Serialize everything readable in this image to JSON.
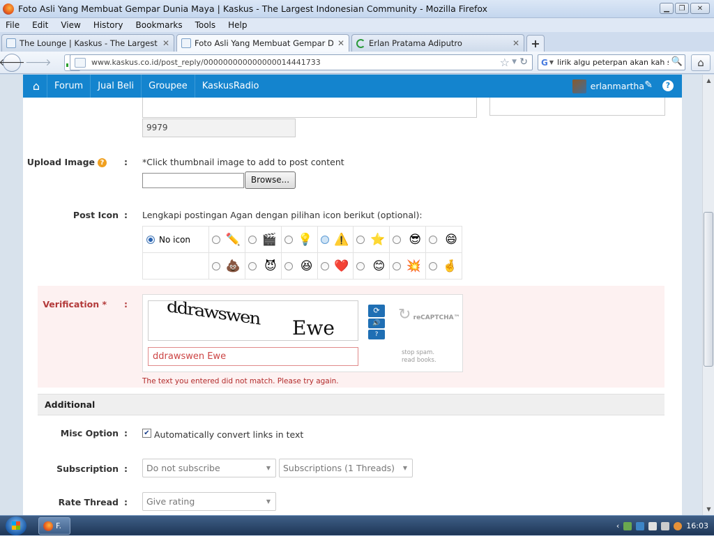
{
  "window": {
    "title": "Foto Asli Yang Membuat Gempar Dunia Maya | Kaskus - The Largest Indonesian Community - Mozilla Firefox",
    "controls": [
      "minimize",
      "maximize",
      "close"
    ]
  },
  "menu": [
    "File",
    "Edit",
    "View",
    "History",
    "Bookmarks",
    "Tools",
    "Help"
  ],
  "tabs": [
    {
      "label": "The Lounge | Kaskus - The Largest Indon..."
    },
    {
      "label": "Foto Asli Yang Membuat Gempar Dunia M..."
    },
    {
      "label": "Erlan Pratama Adiputro"
    }
  ],
  "nav": {
    "url": "www.kaskus.co.id/post_reply/000000000000000014441733",
    "search_query": "lirik algu peterpan akan kah semu"
  },
  "site_nav": {
    "items": [
      "Forum",
      "Jual Beli",
      "Groupee",
      "KaskusRadio"
    ],
    "username": "erlanmartha"
  },
  "form": {
    "char_counter": "9979",
    "upload": {
      "label": "Upload Image",
      "hint": "*Click thumbnail image to add to post content",
      "browse_label": "Browse..."
    },
    "post_icon": {
      "label": "Post Icon",
      "hint": "Lengkapi postingan Agan dengan pilihan icon berikut (optional):",
      "no_icon_label": "No icon",
      "row1": [
        "✏️",
        "🎬",
        "💡",
        "⚠️",
        "⭐",
        "😎",
        "😄"
      ],
      "row2": [
        "💩",
        "😈",
        "😆",
        "❤️",
        "😊",
        "💥",
        "🤞"
      ]
    },
    "verification": {
      "label": "Verification",
      "required_mark": "*",
      "captcha_word1": "ddrawswen",
      "captcha_word2": "Ewe",
      "input_value": "ddrawswen Ewe",
      "recaptcha_brand": "reCAPTCHA™",
      "stop_spam_line1": "stop spam.",
      "stop_spam_line2": "read books.",
      "error": "The text you entered did not match. Please try again."
    },
    "additional": {
      "heading": "Additional",
      "misc_label": "Misc Option",
      "misc_checkbox": "Automatically convert links in text",
      "subscription_label": "Subscription",
      "subscription_value": "Do not subscribe",
      "subscriptions_value": "Subscriptions (1 Threads)",
      "rate_label": "Rate Thread",
      "rate_value": "Give rating"
    }
  },
  "taskbar": {
    "firefox_label": "F.",
    "clock": "16:03"
  }
}
